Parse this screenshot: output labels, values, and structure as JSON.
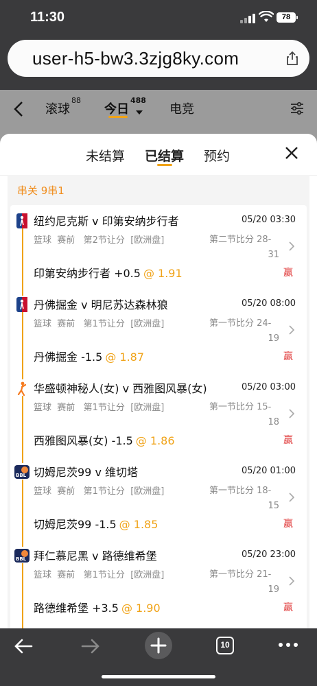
{
  "status": {
    "time": "11:30",
    "battery": "78"
  },
  "browser": {
    "url": "user-h5-bw3.3zjg8ky.com",
    "tabs_count": "10"
  },
  "nav": {
    "tabs": [
      {
        "label": "滚球",
        "badge": "88"
      },
      {
        "label": "今日",
        "badge": "488"
      },
      {
        "label": "电竞",
        "badge": ""
      }
    ]
  },
  "sheet": {
    "tabs": [
      "未结算",
      "已结算",
      "预约"
    ],
    "parlay_label": "串关 9串1"
  },
  "bets": [
    {
      "match": "纽约尼克斯 v 印第安纳步行者",
      "time": "05/20 03:30",
      "meta": "篮球  赛前   第2节让分  [欧洲盘]",
      "score_label": "第二节比分 28-",
      "score_2": "31",
      "pick": "印第安纳步行者 +0.5",
      "odds": "@ 1.91",
      "result": "赢",
      "icon": "nba-icon"
    },
    {
      "match": "丹佛掘金 v 明尼苏达森林狼",
      "time": "05/20 08:00",
      "meta": "篮球  赛前   第1节让分  [欧洲盘]",
      "score_label": "第一节比分 24-",
      "score_2": "19",
      "pick": "丹佛掘金 -1.5",
      "odds": "@ 1.87",
      "result": "赢",
      "icon": "nba-icon"
    },
    {
      "match": "华盛顿神秘人(女) v 西雅图风暴(女)",
      "time": "05/20 03:00",
      "meta": "篮球  赛前   第1节让分  [欧洲盘]",
      "score_label": "第一节比分 15-",
      "score_2": "18",
      "pick": "西雅图风暴(女) -1.5",
      "odds": "@ 1.86",
      "result": "赢",
      "icon": "wnba-icon"
    },
    {
      "match": "切姆尼茨99 v 维切塔",
      "time": "05/20 01:00",
      "meta": "篮球  赛前   第1节让分  [欧洲盘]",
      "score_label": "第一节比分 18-",
      "score_2": "15",
      "pick": "切姆尼茨99 -1.5",
      "odds": "@ 1.85",
      "result": "赢",
      "icon": "bbl-icon"
    },
    {
      "match": "拜仁慕尼黑 v 路德维希堡",
      "time": "05/20 23:00",
      "meta": "篮球  赛前   第1节让分  [欧洲盘]",
      "score_label": "第一节比分 21-",
      "score_2": "19",
      "pick": "路德维希堡 +3.5",
      "odds": "@ 1.90",
      "result": "赢",
      "icon": "bbl-icon"
    }
  ],
  "colors": {
    "accent": "#f0a318",
    "win": "#e03c3c"
  }
}
